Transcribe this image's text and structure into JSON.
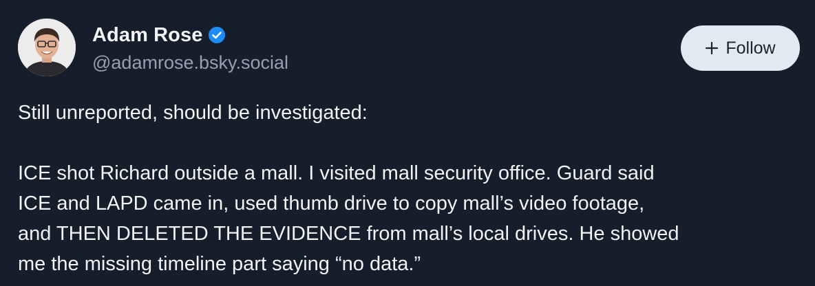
{
  "author": {
    "display_name": "Adam Rose",
    "handle": "@adamrose.bsky.social",
    "verified": true,
    "avatar_icon": "profile-photo"
  },
  "actions": {
    "follow_label": "Follow",
    "follow_icon": "plus-icon"
  },
  "post": {
    "line_1": "Still unreported, should be investigated:",
    "body_lines": [
      "ICE shot Richard outside a mall. I visited mall security office. Guard said",
      "ICE and LAPD came in, used thumb drive to copy mall’s video footage,",
      "and THEN DELETED THE EVIDENCE from mall’s local drives. He showed",
      "me the missing timeline part saying “no data.”"
    ]
  },
  "colors": {
    "background": "#161e2b",
    "text": "#f1f3f5",
    "muted": "#93a1b3",
    "verified_blue": "#1d8cf8",
    "follow_bg": "#e3e9f1"
  }
}
